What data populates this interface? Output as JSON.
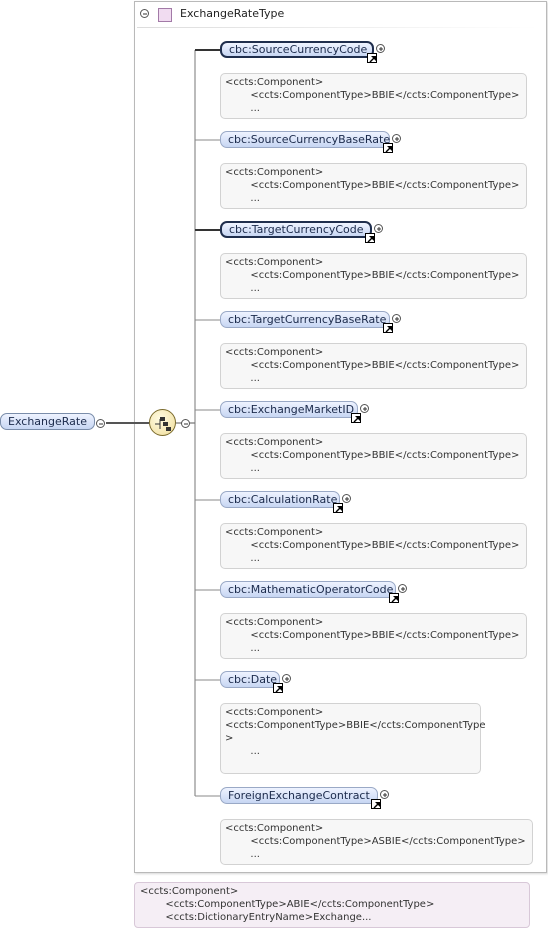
{
  "root": {
    "label": "ExchangeRate"
  },
  "type_box": {
    "name": "ExchangeRateType"
  },
  "elements": [
    {
      "label": "cbc:SourceCurrencyCode",
      "required": true,
      "doc": [
        "<ccts:Component>",
        "        <ccts:ComponentType>BBIE</ccts:ComponentType>",
        "        ..."
      ]
    },
    {
      "label": "cbc:SourceCurrencyBaseRate",
      "required": false,
      "doc": [
        "<ccts:Component>",
        "        <ccts:ComponentType>BBIE</ccts:ComponentType>",
        "        ..."
      ]
    },
    {
      "label": "cbc:TargetCurrencyCode",
      "required": true,
      "doc": [
        "<ccts:Component>",
        "        <ccts:ComponentType>BBIE</ccts:ComponentType>",
        "        ..."
      ]
    },
    {
      "label": "cbc:TargetCurrencyBaseRate",
      "required": false,
      "doc": [
        "<ccts:Component>",
        "        <ccts:ComponentType>BBIE</ccts:ComponentType>",
        "        ..."
      ]
    },
    {
      "label": "cbc:ExchangeMarketID",
      "required": false,
      "doc": [
        "<ccts:Component>",
        "        <ccts:ComponentType>BBIE</ccts:ComponentType>",
        "        ..."
      ]
    },
    {
      "label": "cbc:CalculationRate",
      "required": false,
      "doc": [
        "<ccts:Component>",
        "        <ccts:ComponentType>BBIE</ccts:ComponentType>",
        "        ..."
      ]
    },
    {
      "label": "cbc:MathematicOperatorCode",
      "required": false,
      "doc": [
        "<ccts:Component>",
        "        <ccts:ComponentType>BBIE</ccts:ComponentType>",
        "        ..."
      ]
    },
    {
      "label": "cbc:Date",
      "required": false,
      "doc": [
        "<ccts:Component>",
        "",
        "<ccts:ComponentType>BBIE</ccts:ComponentType",
        ">",
        "        ..."
      ]
    },
    {
      "label": "ForeignExchangeContract",
      "required": false,
      "doc": [
        "<ccts:Component>",
        "        <ccts:ComponentType>ASBIE</ccts:ComponentType>",
        "        ..."
      ]
    }
  ],
  "bottom_doc": [
    "<ccts:Component>",
    "        <ccts:ComponentType>ABIE</ccts:ComponentType>",
    "        <ccts:DictionaryEntryName>Exchange..."
  ],
  "colors": {
    "element_fill": "#c7d6f3",
    "sequence_fill": "#f0dd9a",
    "doc_fill": "#f7f7f7"
  },
  "icons": {
    "collapse": "minus-circle-icon",
    "expand": "plus-circle-icon",
    "reference": "reference-arrow-icon",
    "sequence": "sequence-compositor-icon",
    "complex_type": "complex-type-icon"
  }
}
